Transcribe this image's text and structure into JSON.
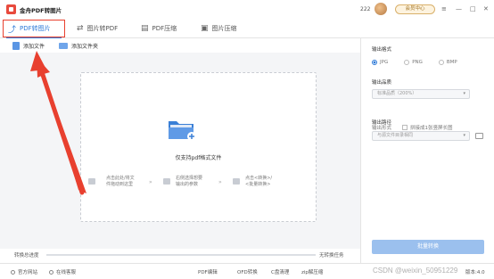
{
  "app": {
    "title": "金舟PDF转图片"
  },
  "titlebar": {
    "user_count": "222",
    "vip_label": "会员中心",
    "menu_icon": "≡",
    "min_icon": "—",
    "max_icon": "□",
    "close_icon": "✕"
  },
  "tabs": [
    {
      "label": "PDF转图片",
      "icon": "pdf-to-image-icon",
      "active": true
    },
    {
      "label": "图片转PDF",
      "icon": "image-to-pdf-icon",
      "active": false
    },
    {
      "label": "PDF压缩",
      "icon": "pdf-compress-icon",
      "active": false
    },
    {
      "label": "图片压缩",
      "icon": "image-compress-icon",
      "active": false
    }
  ],
  "toolbar": {
    "add_file": "添加文件",
    "add_folder": "添加文件夹"
  },
  "dropzone": {
    "text": "仅支持pdf格式文件",
    "step1_line1": "点击此处/将文",
    "step1_line2": "件拖动到这里",
    "step2_line1": "右侧选择想要",
    "step2_line2": "输出的参数",
    "step3_line1": "点击<转换>/",
    "step3_line2": "<批量转换>"
  },
  "progress": {
    "label": "转换总进度",
    "status": "无转换任务",
    "fraction": 0
  },
  "right_panel": {
    "format_title": "输出格式",
    "formats": [
      "JPG",
      "PNG",
      "BMP"
    ],
    "selected_format": "JPG",
    "quality_title": "输出品质",
    "quality_value": "标准品质（200%）",
    "form_title": "输出形式",
    "form_option": "拼接成1张竖屏长图",
    "path_title": "输出路径",
    "path_value": "与源文件目录相同",
    "convert_button": "批量转换"
  },
  "statusbar": {
    "website": "官方网站",
    "service": "在线客服",
    "links": [
      "PDF编辑",
      "OFD转换",
      "C盘清理",
      "zip解压缩"
    ],
    "version": "版本:4.0"
  },
  "watermark": "CSDN @weixin_50951229",
  "colors": {
    "accent": "#2f7bd8",
    "highlight": "#e8402f",
    "button_disabled": "#9bc0ee"
  }
}
